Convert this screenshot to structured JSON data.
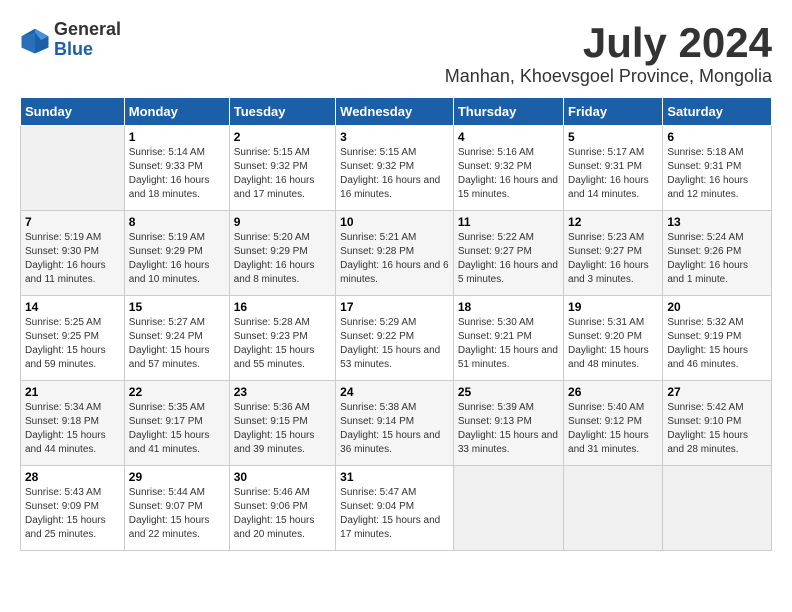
{
  "logo": {
    "general": "General",
    "blue": "Blue"
  },
  "header": {
    "title": "July 2024",
    "subtitle": "Manhan, Khoevsgoel Province, Mongolia"
  },
  "weekdays": [
    "Sunday",
    "Monday",
    "Tuesday",
    "Wednesday",
    "Thursday",
    "Friday",
    "Saturday"
  ],
  "weeks": [
    [
      {
        "day": "",
        "sunrise": "",
        "sunset": "",
        "daylight": ""
      },
      {
        "day": "1",
        "sunrise": "Sunrise: 5:14 AM",
        "sunset": "Sunset: 9:33 PM",
        "daylight": "Daylight: 16 hours and 18 minutes."
      },
      {
        "day": "2",
        "sunrise": "Sunrise: 5:15 AM",
        "sunset": "Sunset: 9:32 PM",
        "daylight": "Daylight: 16 hours and 17 minutes."
      },
      {
        "day": "3",
        "sunrise": "Sunrise: 5:15 AM",
        "sunset": "Sunset: 9:32 PM",
        "daylight": "Daylight: 16 hours and 16 minutes."
      },
      {
        "day": "4",
        "sunrise": "Sunrise: 5:16 AM",
        "sunset": "Sunset: 9:32 PM",
        "daylight": "Daylight: 16 hours and 15 minutes."
      },
      {
        "day": "5",
        "sunrise": "Sunrise: 5:17 AM",
        "sunset": "Sunset: 9:31 PM",
        "daylight": "Daylight: 16 hours and 14 minutes."
      },
      {
        "day": "6",
        "sunrise": "Sunrise: 5:18 AM",
        "sunset": "Sunset: 9:31 PM",
        "daylight": "Daylight: 16 hours and 12 minutes."
      }
    ],
    [
      {
        "day": "7",
        "sunrise": "Sunrise: 5:19 AM",
        "sunset": "Sunset: 9:30 PM",
        "daylight": "Daylight: 16 hours and 11 minutes."
      },
      {
        "day": "8",
        "sunrise": "Sunrise: 5:19 AM",
        "sunset": "Sunset: 9:29 PM",
        "daylight": "Daylight: 16 hours and 10 minutes."
      },
      {
        "day": "9",
        "sunrise": "Sunrise: 5:20 AM",
        "sunset": "Sunset: 9:29 PM",
        "daylight": "Daylight: 16 hours and 8 minutes."
      },
      {
        "day": "10",
        "sunrise": "Sunrise: 5:21 AM",
        "sunset": "Sunset: 9:28 PM",
        "daylight": "Daylight: 16 hours and 6 minutes."
      },
      {
        "day": "11",
        "sunrise": "Sunrise: 5:22 AM",
        "sunset": "Sunset: 9:27 PM",
        "daylight": "Daylight: 16 hours and 5 minutes."
      },
      {
        "day": "12",
        "sunrise": "Sunrise: 5:23 AM",
        "sunset": "Sunset: 9:27 PM",
        "daylight": "Daylight: 16 hours and 3 minutes."
      },
      {
        "day": "13",
        "sunrise": "Sunrise: 5:24 AM",
        "sunset": "Sunset: 9:26 PM",
        "daylight": "Daylight: 16 hours and 1 minute."
      }
    ],
    [
      {
        "day": "14",
        "sunrise": "Sunrise: 5:25 AM",
        "sunset": "Sunset: 9:25 PM",
        "daylight": "Daylight: 15 hours and 59 minutes."
      },
      {
        "day": "15",
        "sunrise": "Sunrise: 5:27 AM",
        "sunset": "Sunset: 9:24 PM",
        "daylight": "Daylight: 15 hours and 57 minutes."
      },
      {
        "day": "16",
        "sunrise": "Sunrise: 5:28 AM",
        "sunset": "Sunset: 9:23 PM",
        "daylight": "Daylight: 15 hours and 55 minutes."
      },
      {
        "day": "17",
        "sunrise": "Sunrise: 5:29 AM",
        "sunset": "Sunset: 9:22 PM",
        "daylight": "Daylight: 15 hours and 53 minutes."
      },
      {
        "day": "18",
        "sunrise": "Sunrise: 5:30 AM",
        "sunset": "Sunset: 9:21 PM",
        "daylight": "Daylight: 15 hours and 51 minutes."
      },
      {
        "day": "19",
        "sunrise": "Sunrise: 5:31 AM",
        "sunset": "Sunset: 9:20 PM",
        "daylight": "Daylight: 15 hours and 48 minutes."
      },
      {
        "day": "20",
        "sunrise": "Sunrise: 5:32 AM",
        "sunset": "Sunset: 9:19 PM",
        "daylight": "Daylight: 15 hours and 46 minutes."
      }
    ],
    [
      {
        "day": "21",
        "sunrise": "Sunrise: 5:34 AM",
        "sunset": "Sunset: 9:18 PM",
        "daylight": "Daylight: 15 hours and 44 minutes."
      },
      {
        "day": "22",
        "sunrise": "Sunrise: 5:35 AM",
        "sunset": "Sunset: 9:17 PM",
        "daylight": "Daylight: 15 hours and 41 minutes."
      },
      {
        "day": "23",
        "sunrise": "Sunrise: 5:36 AM",
        "sunset": "Sunset: 9:15 PM",
        "daylight": "Daylight: 15 hours and 39 minutes."
      },
      {
        "day": "24",
        "sunrise": "Sunrise: 5:38 AM",
        "sunset": "Sunset: 9:14 PM",
        "daylight": "Daylight: 15 hours and 36 minutes."
      },
      {
        "day": "25",
        "sunrise": "Sunrise: 5:39 AM",
        "sunset": "Sunset: 9:13 PM",
        "daylight": "Daylight: 15 hours and 33 minutes."
      },
      {
        "day": "26",
        "sunrise": "Sunrise: 5:40 AM",
        "sunset": "Sunset: 9:12 PM",
        "daylight": "Daylight: 15 hours and 31 minutes."
      },
      {
        "day": "27",
        "sunrise": "Sunrise: 5:42 AM",
        "sunset": "Sunset: 9:10 PM",
        "daylight": "Daylight: 15 hours and 28 minutes."
      }
    ],
    [
      {
        "day": "28",
        "sunrise": "Sunrise: 5:43 AM",
        "sunset": "Sunset: 9:09 PM",
        "daylight": "Daylight: 15 hours and 25 minutes."
      },
      {
        "day": "29",
        "sunrise": "Sunrise: 5:44 AM",
        "sunset": "Sunset: 9:07 PM",
        "daylight": "Daylight: 15 hours and 22 minutes."
      },
      {
        "day": "30",
        "sunrise": "Sunrise: 5:46 AM",
        "sunset": "Sunset: 9:06 PM",
        "daylight": "Daylight: 15 hours and 20 minutes."
      },
      {
        "day": "31",
        "sunrise": "Sunrise: 5:47 AM",
        "sunset": "Sunset: 9:04 PM",
        "daylight": "Daylight: 15 hours and 17 minutes."
      },
      {
        "day": "",
        "sunrise": "",
        "sunset": "",
        "daylight": ""
      },
      {
        "day": "",
        "sunrise": "",
        "sunset": "",
        "daylight": ""
      },
      {
        "day": "",
        "sunrise": "",
        "sunset": "",
        "daylight": ""
      }
    ]
  ]
}
